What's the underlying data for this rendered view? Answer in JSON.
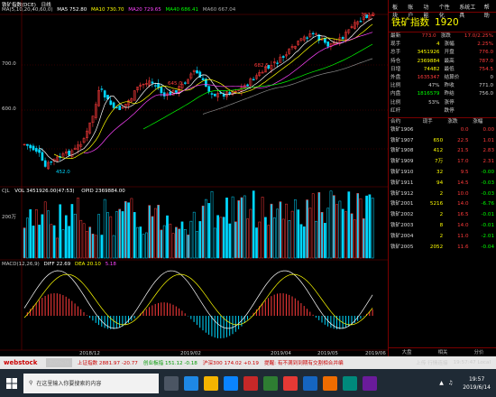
{
  "chart_header": {
    "title": "铁矿指数(DCE)",
    "period": "日线",
    "ma_label": "MA(5,10,20,40,60,0)",
    "ma5": "MA5 752.80",
    "ma10": "MA10 730.70",
    "ma20": "MA20 729.65",
    "ma40": "MA40 686.41",
    "ma60": "MA60 667.04"
  },
  "price_axis": [
    "700.0",
    "600.0"
  ],
  "price_annotations": [
    "787.0",
    "682.5",
    "645.0",
    "452.0"
  ],
  "volume_header": {
    "label": "CJL",
    "vol": "VOL 3451926.00(47:53)",
    "oi": "OPID 2369884.00"
  },
  "volume_axis": [
    "200万"
  ],
  "macd_header": {
    "label": "MACD(12,26,9)",
    "dif": "DIFF 22.69",
    "dea": "DEA 20.10",
    "macd": "5.18"
  },
  "date_axis": [
    "2018/12",
    "2019/02",
    "2019/04",
    "2019/05",
    "2019/06"
  ],
  "panel": {
    "menu": [
      "板块",
      "账户",
      "功能",
      "个性化",
      "系统工具",
      "帮助"
    ],
    "name": "铁矿指数",
    "code": "1920",
    "quote_rows": [
      {
        "l1": "最新",
        "v1": "773.0",
        "l2": "涨跌",
        "v2": "17.0/2.25%"
      },
      {
        "l1": "现手",
        "v1": "4",
        "l2": "涨幅",
        "v2": "2.25%"
      },
      {
        "l1": "总手",
        "v1": "3451926",
        "l2": "开盘",
        "v2": "776.0"
      },
      {
        "l1": "持仓",
        "v1": "2369884",
        "l2": "最高",
        "v2": "787.0"
      },
      {
        "l1": "日增",
        "v1": "74482",
        "l2": "最低",
        "v2": "754.5"
      },
      {
        "l1": "外盘",
        "v1": "1635347",
        "l2": "结算价",
        "v2": "0"
      },
      {
        "l1": "比例",
        "v1": "47%",
        "l2": "昨收",
        "v2": "771.0"
      },
      {
        "l1": "内盘",
        "v1": "1816579",
        "l2": "昨结",
        "v2": "756.0"
      },
      {
        "l1": "比例",
        "v1": "53%",
        "l2": "涨停",
        "v2": ""
      },
      {
        "l1": "红杆",
        "v1": "",
        "l2": "跌停",
        "v2": ""
      }
    ],
    "contracts_header": [
      "合约",
      "现手",
      "涨跌",
      "涨幅"
    ],
    "contracts": [
      {
        "name": "铁矿1906",
        "vol": "",
        "chg": "0.0",
        "pct": "0.00"
      },
      {
        "name": "铁矿1907",
        "vol": "650",
        "chg": "22.5",
        "pct": "1.01"
      },
      {
        "name": "铁矿1908",
        "vol": "412",
        "chg": "21.5",
        "pct": "2.83"
      },
      {
        "name": "铁矿1909",
        "vol": "7万",
        "chg": "17.0",
        "pct": "2.31"
      },
      {
        "name": "铁矿1910",
        "vol": "32",
        "chg": "9.5",
        "pct": "-0.00"
      },
      {
        "name": "铁矿1911",
        "vol": "94",
        "chg": "14.5",
        "pct": "-0.03"
      },
      {
        "name": "铁矿1912",
        "vol": "2",
        "chg": "10.0",
        "pct": "-0.03"
      },
      {
        "name": "铁矿2001",
        "vol": "5216",
        "chg": "14.0",
        "pct": "-6.76"
      },
      {
        "name": "铁矿2002",
        "vol": "2",
        "chg": "16.5",
        "pct": "-0.01"
      },
      {
        "name": "铁矿2003",
        "vol": "8",
        "chg": "14.0",
        "pct": "-0.01"
      },
      {
        "name": "铁矿2004",
        "vol": "2",
        "chg": "11.0",
        "pct": "-2.01"
      },
      {
        "name": "铁矿2005",
        "vol": "2052",
        "chg": "11.6",
        "pct": "-0.04"
      }
    ],
    "tabs": [
      "大盘",
      "相关",
      "分价"
    ]
  },
  "status_bar": {
    "logo": "webstock",
    "tab": "我的板块",
    "sh": "上证指数 2881.97 -20.77",
    "cy": "创业板指 151.12 -0.18",
    "hs": "沪深300 174.02 +0.19",
    "tip": "提醒: 有不满到到期有交割相合并编",
    "conn": "上传 行情连接",
    "time": "19:57:47 Local"
  },
  "taskbar": {
    "search_placeholder": "在这里输入你要搜索的内容",
    "time": "19:57",
    "date": "2019/6/14"
  },
  "colors": {
    "up": "#ff3b3b",
    "down": "#00d8ff",
    "bg": "#000000",
    "grid": "#7a0000",
    "yellow": "#ffff00"
  }
}
